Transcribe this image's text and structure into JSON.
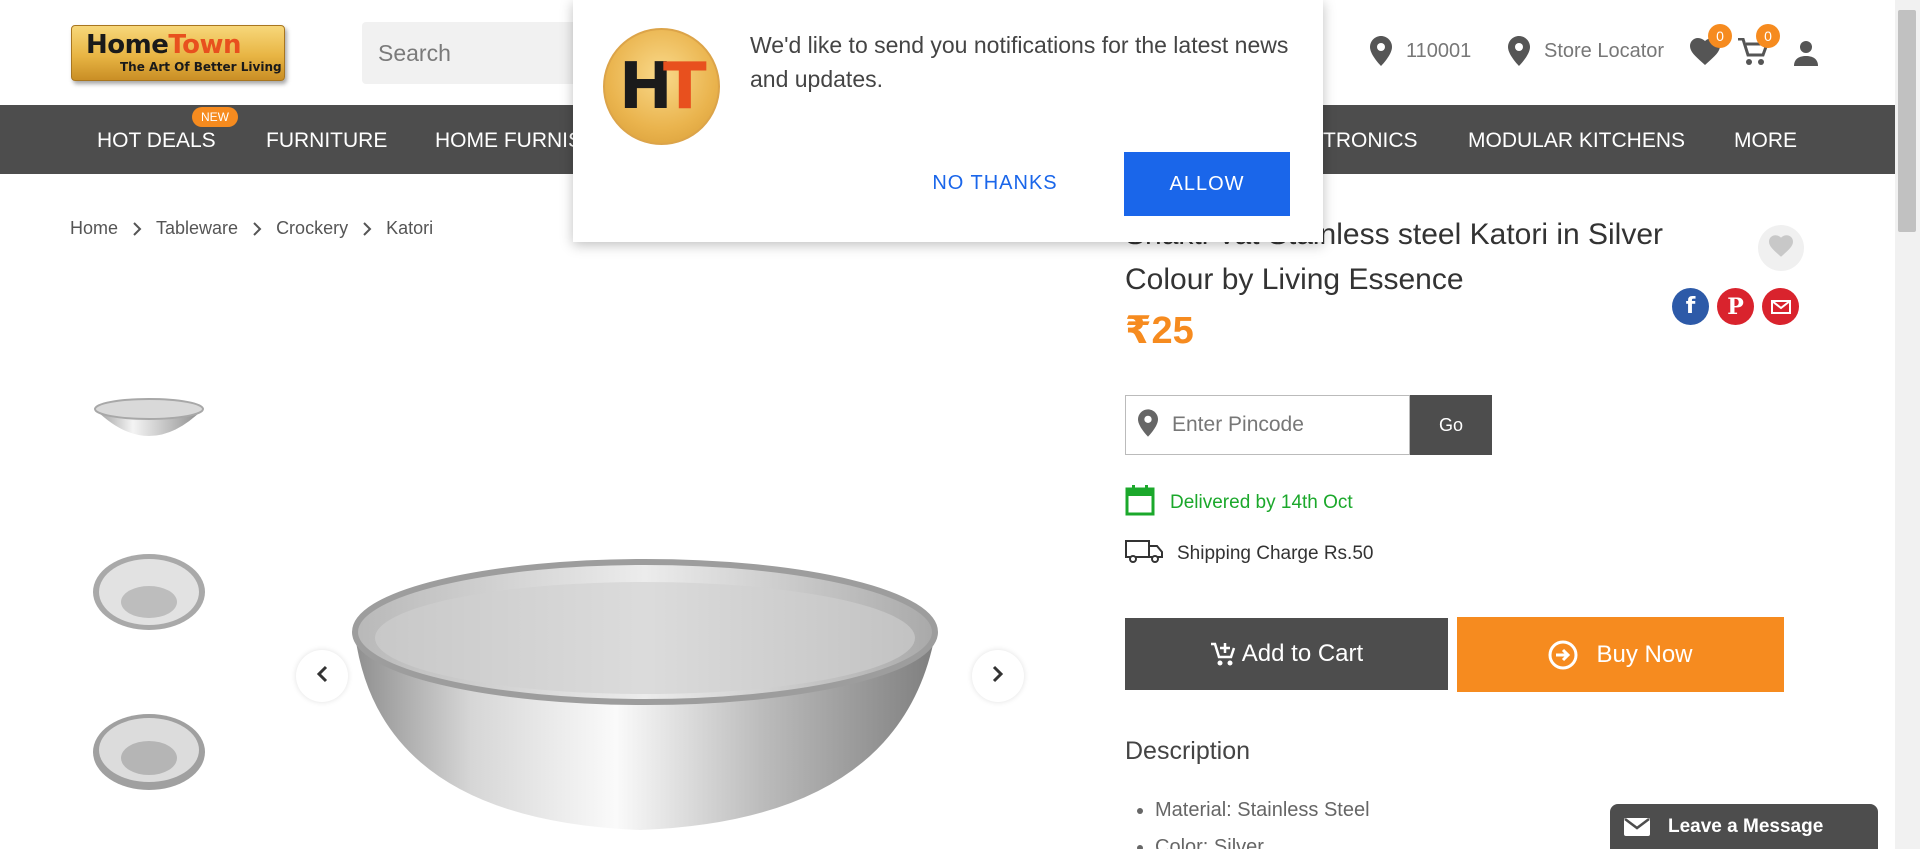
{
  "header": {
    "logo": {
      "line1_home": "Home",
      "line1_town": "Town",
      "line2": "The Art Of Better Living"
    },
    "search_placeholder": "Search",
    "pincode": "110001",
    "store_locator": "Store Locator",
    "wishlist_count": "0",
    "cart_count": "0"
  },
  "nav": {
    "items": [
      "HOT DEALS",
      "FURNITURE",
      "HOME FURNIS",
      "TRONICS",
      "MODULAR KITCHENS",
      "MORE"
    ],
    "new_badge": "NEW"
  },
  "breadcrumb": [
    "Home",
    "Tableware",
    "Crockery",
    "Katori"
  ],
  "product": {
    "title_line1": "Shakti Vat Stainless steel Katori in Silver",
    "title_line2": "Colour by Living Essence",
    "price": "₹25",
    "pincode_placeholder": "Enter Pincode",
    "go_label": "Go",
    "delivery": "Delivered by 14th Oct",
    "shipping": "Shipping Charge Rs.50",
    "add_to_cart": "Add to Cart",
    "buy_now": "Buy Now",
    "description_title": "Description",
    "description_items": [
      "Material: Stainless Steel",
      "Color: Silver"
    ]
  },
  "popup": {
    "logo_h": "H",
    "logo_t": "T",
    "message": "We'd like to send you notifications for the latest news and updates.",
    "no_thanks": "NO THANKS",
    "allow": "ALLOW"
  },
  "chat": {
    "label": "Leave a Message"
  },
  "colors": {
    "accent": "#f68b1f",
    "nav_bg": "#4d4d4d",
    "allow_blue": "#1a66ea",
    "delivery_green": "#1ba82b"
  }
}
